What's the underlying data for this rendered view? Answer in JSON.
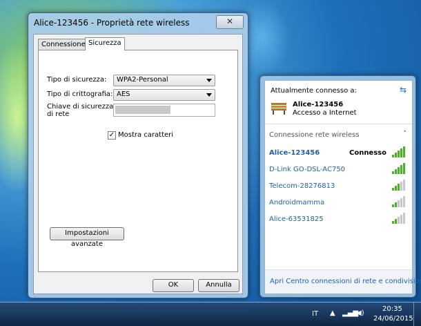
{
  "dialog": {
    "title": "Alice-123456 - Proprietà rete wireless",
    "close_glyph": "✕",
    "tabs": [
      {
        "label": "Connessione"
      },
      {
        "label": "Sicurezza"
      }
    ],
    "security_type_label": "Tipo di sicurezza:",
    "security_type_value": "WPA2-Personal",
    "encryption_label": "Tipo di crittografia:",
    "encryption_value": "AES",
    "key_label_line1": "Chiave di sicurezza",
    "key_label_line2": "di rete",
    "show_chars_label": "Mostra caratteri",
    "show_chars_checked": "✓",
    "advanced_button": "Impostazioni avanzate",
    "ok_button": "OK",
    "cancel_button": "Annulla"
  },
  "flyout": {
    "connected_heading": "Attualmente connesso a:",
    "current_network": "Alice-123456",
    "current_status": "Accesso a Internet",
    "section_title": "Connessione rete wireless",
    "section_chevron": "˄",
    "networks": [
      {
        "name": "Alice-123456",
        "status": "Connesso",
        "signal": 5
      },
      {
        "name": "D-Link GO-DSL-AC750",
        "status": "",
        "signal": 5
      },
      {
        "name": "Telecom-28276813",
        "status": "",
        "signal": 3
      },
      {
        "name": "Androidmamma",
        "status": "",
        "signal": 2
      },
      {
        "name": "Alice-63531825",
        "status": "",
        "signal": 2
      }
    ],
    "footer_link": "Apri Centro connessioni di rete e condivisione",
    "signal_color": "#4bb02a"
  },
  "taskbar": {
    "language": "IT",
    "time": "20:35",
    "date": "24/06/2015"
  }
}
